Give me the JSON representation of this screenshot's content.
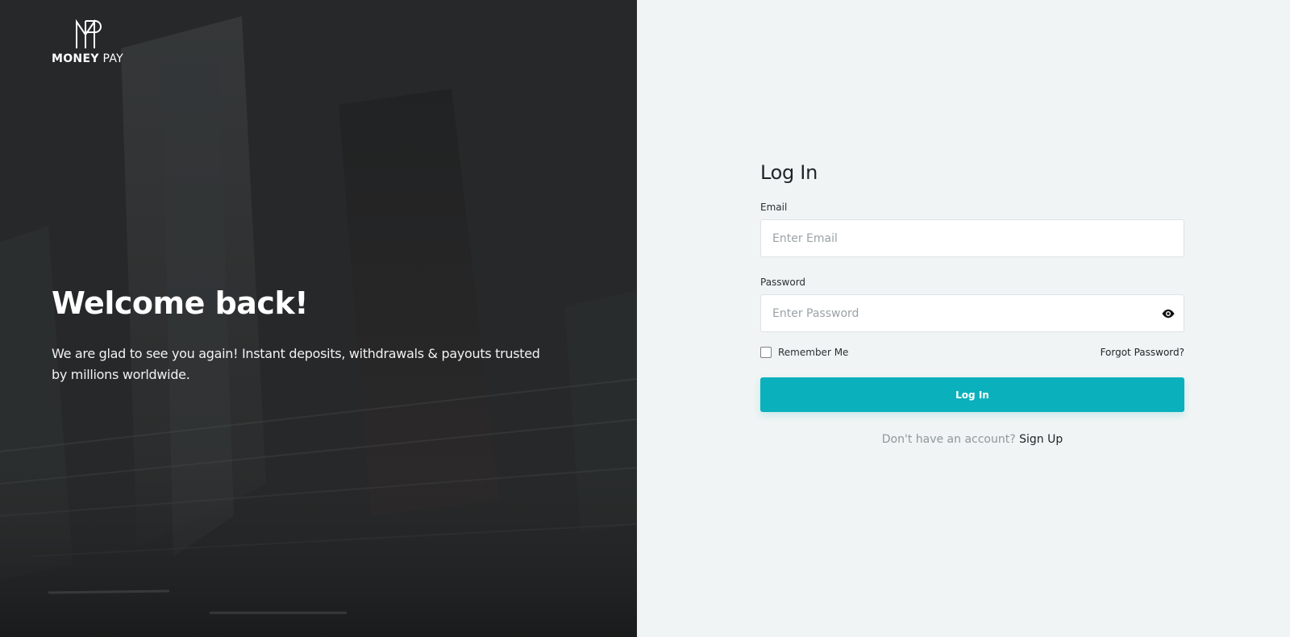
{
  "brand": {
    "logo_icon": "money-pay-logo-mark",
    "name_strong": "MONEY",
    "name_light": " PAY"
  },
  "hero": {
    "title": "Welcome back!",
    "subtitle": "We are glad to see you again! Instant deposits, withdrawals & payouts trusted by millions worldwide."
  },
  "login": {
    "title": "Log In",
    "email_label": "Email",
    "email_placeholder": "Enter Email",
    "email_value": "",
    "password_label": "Password",
    "password_placeholder": "Enter Password",
    "password_value": "",
    "password_toggle_icon": "eye-icon",
    "remember_label": "Remember Me",
    "remember_checked": false,
    "forgot_label": "Forgot Password?",
    "submit_label": "Log In",
    "signup_prompt": "Don't have an account?",
    "signup_link": "Sign Up"
  },
  "colors": {
    "accent": "#0ab1bc",
    "panel_bg": "#f0f4f4",
    "hero_bg": "#232526"
  }
}
